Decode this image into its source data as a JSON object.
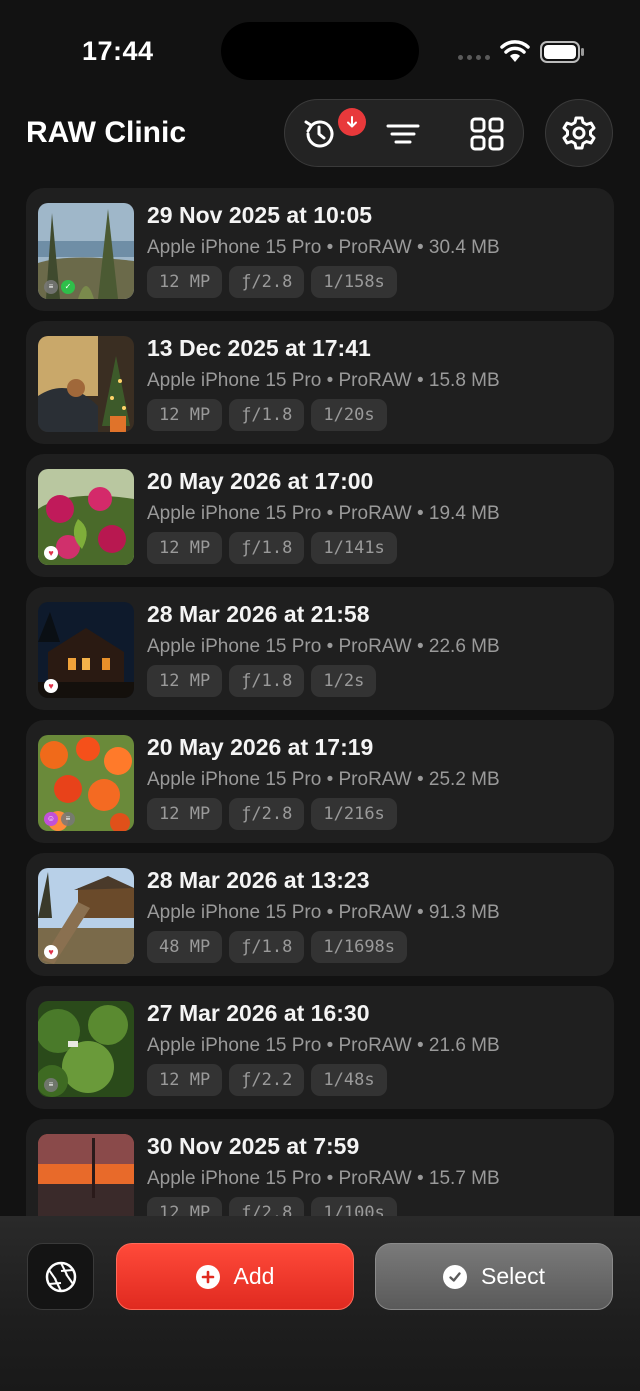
{
  "status_bar": {
    "time": "17:44"
  },
  "header": {
    "title": "RAW Clinic"
  },
  "toolbar": {
    "history_icon": "history-icon",
    "download_badge_icon": "download-arrow-icon",
    "sort_icon": "sort-lines-icon",
    "grid_icon": "grid-icon",
    "settings_icon": "gear-icon"
  },
  "photos": [
    {
      "title": "29 Nov 2025 at 10:05",
      "meta": "Apple iPhone 15 Pro • ProRAW • 30.4 MB",
      "mp": "12 MP",
      "aperture": "ƒ/2.8",
      "shutter": "1/158s",
      "badges": [
        "menu",
        "check"
      ]
    },
    {
      "title": "13 Dec 2025 at 17:41",
      "meta": "Apple iPhone 15 Pro • ProRAW • 15.8 MB",
      "mp": "12 MP",
      "aperture": "ƒ/1.8",
      "shutter": "1/20s",
      "badges": []
    },
    {
      "title": "20 May 2026 at 17:00",
      "meta": "Apple iPhone 15 Pro • ProRAW • 19.4 MB",
      "mp": "12 MP",
      "aperture": "ƒ/1.8",
      "shutter": "1/141s",
      "badges": [
        "heart"
      ]
    },
    {
      "title": "28 Mar 2026 at 21:58",
      "meta": "Apple iPhone 15 Pro • ProRAW • 22.6 MB",
      "mp": "12 MP",
      "aperture": "ƒ/1.8",
      "shutter": "1/2s",
      "badges": [
        "heart"
      ]
    },
    {
      "title": "20 May 2026 at 17:19",
      "meta": "Apple iPhone 15 Pro • ProRAW • 25.2 MB",
      "mp": "12 MP",
      "aperture": "ƒ/2.8",
      "shutter": "1/216s",
      "badges": [
        "face",
        "menu"
      ]
    },
    {
      "title": "28 Mar 2026 at 13:23",
      "meta": "Apple iPhone 15 Pro • ProRAW • 91.3 MB",
      "mp": "48 MP",
      "aperture": "ƒ/1.8",
      "shutter": "1/1698s",
      "badges": [
        "heart"
      ]
    },
    {
      "title": "27 Mar 2026 at 16:30",
      "meta": "Apple iPhone 15 Pro • ProRAW • 21.6 MB",
      "mp": "12 MP",
      "aperture": "ƒ/2.2",
      "shutter": "1/48s",
      "badges": [
        "menu"
      ]
    },
    {
      "title": "30 Nov 2025 at 7:59",
      "meta": "Apple iPhone 15 Pro • ProRAW • 15.7 MB",
      "mp": "12 MP",
      "aperture": "ƒ/2.8",
      "shutter": "1/100s",
      "badges": []
    }
  ],
  "bottom_bar": {
    "aperture_icon": "aperture-icon",
    "add_label": "Add",
    "add_icon": "plus-circle-icon",
    "select_label": "Select",
    "select_icon": "checkmark-circle-icon"
  },
  "colors": {
    "accent_red": "#e8393b",
    "card_bg": "#1f1f1f",
    "chip_bg": "#333333"
  }
}
